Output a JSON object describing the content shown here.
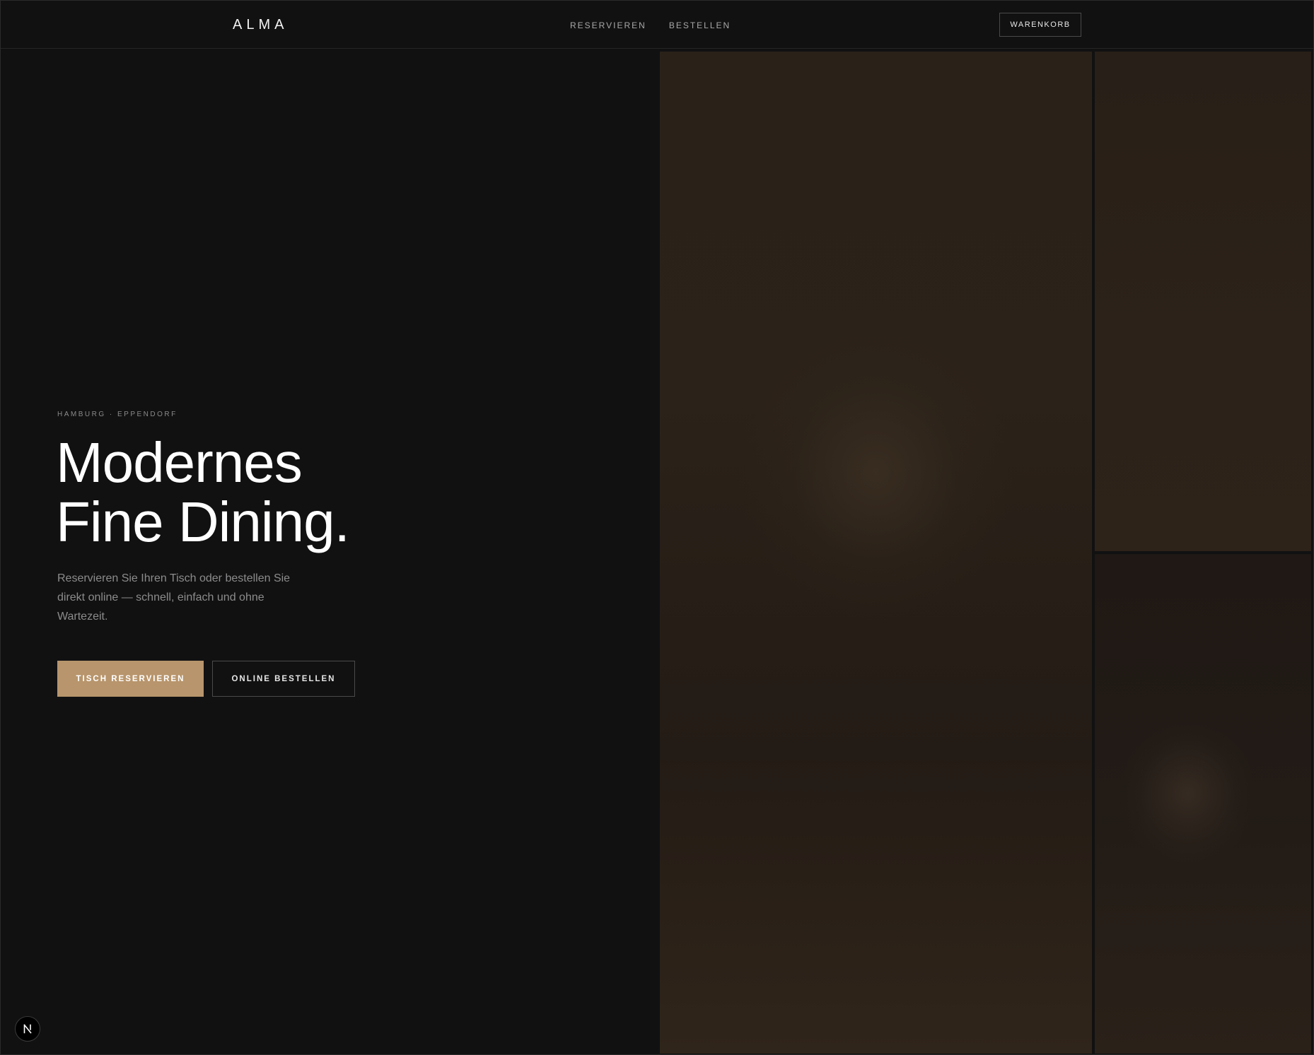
{
  "header": {
    "logo": "ALMA",
    "nav": [
      {
        "label": "RESERVIEREN"
      },
      {
        "label": "BESTELLEN"
      }
    ],
    "cart_label": "WARENKORB"
  },
  "hero": {
    "eyebrow": "HAMBURG · EPPENDORF",
    "headline_line1": "Modernes",
    "headline_line2": "Fine Dining.",
    "lead": "Reservieren Sie Ihren Tisch oder bestellen Sie direkt online — schnell, einfach und ohne Wartezeit.",
    "primary_button": "TISCH RESERVIEREN",
    "secondary_button": "ONLINE BESTELLEN"
  },
  "colors": {
    "background": "#111112",
    "accent": "#b8956c",
    "panel_tone": "#2a2219"
  },
  "icons": {
    "dev_indicator": "nextjs-logo-icon"
  }
}
